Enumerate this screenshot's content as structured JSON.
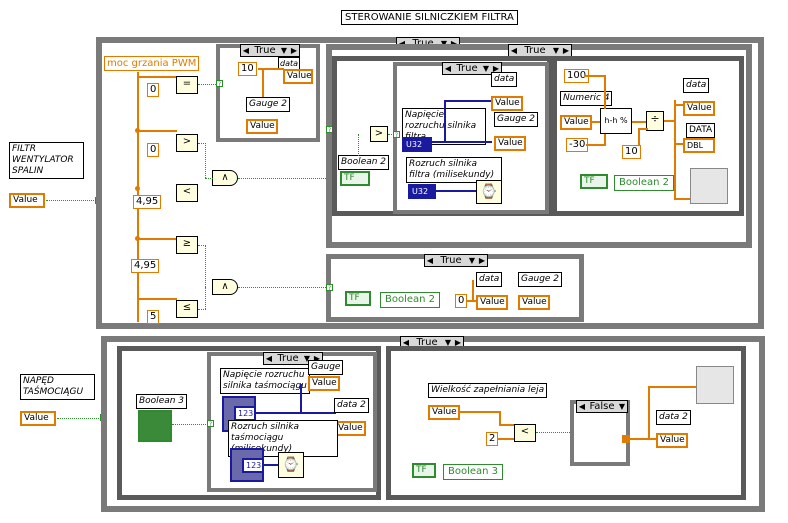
{
  "title": "STEROWANIE SILNICZKIEM FILTRA",
  "filter_control": {
    "label": "FILTR WENTYLATOR SPALIN",
    "value_label": "Value"
  },
  "conveyor_control": {
    "label": "NAPĘD TAŚMOCIĄGU",
    "value_label": "Value"
  },
  "pwm_label": "moc grzania  PWM",
  "constants": {
    "c0a": "0",
    "c0b": "0",
    "c495a": "4,95",
    "c495b": "4,95",
    "c5": "5",
    "c10a": "10",
    "c100": "100",
    "c_30": "-30",
    "c10b": "10",
    "c0c": "0",
    "c2": "2"
  },
  "comparators": {
    "eq": "=",
    "gt1": ">",
    "lt1": "<",
    "ge": "≥",
    "le": "≤",
    "gt2": ">",
    "lt2": "<"
  },
  "and_gate": "∧",
  "selectors": {
    "top_small": "True",
    "big_outer": "True",
    "right_middle": "True",
    "inner_true": "True",
    "lower_case": "True",
    "bottom_outer": "True",
    "bottom_inner": "True",
    "false_case": "False"
  },
  "labels": {
    "gauge2": "Gauge 2",
    "gauge2b": "Gauge 2",
    "gauge2c": "Gauge 2",
    "boolean2": "Boolean 2",
    "boolean2b": "Boolean 2",
    "boolean2c": "Boolean 2",
    "data": "data",
    "data_b": "data",
    "data_c": "data",
    "data_upper": "DATA",
    "data2": "data 2",
    "data2b": "data 2",
    "napiecie_filtr": "Napięcie rozruchu silnika filtra",
    "rozruch_filtr": "Rozruch silnika filtra (milisekundy)",
    "numeric4": "Numeric 4",
    "boolean3": "Boolean 3",
    "boolean3b": "Boolean 3",
    "napiecie_tasm": "Napięcie rozruchu silnika taśmociągu",
    "rozruch_tasm": "Rozruch silnika taśmociągu (milisekundy)",
    "gauge_bottom": "Gauge",
    "wielkosc": "Wielkość zapełniania leja",
    "value": "Value",
    "tf": "TF",
    "u32": "U32",
    "dbl": "DBL",
    "i123": "123"
  }
}
